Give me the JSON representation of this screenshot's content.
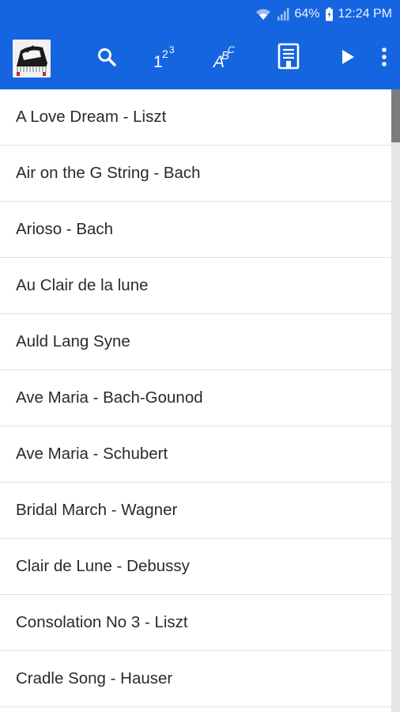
{
  "status_bar": {
    "battery_percent": "64%",
    "time": "12:24 PM",
    "icons": [
      "wifi-icon",
      "signal-icon",
      "battery-icon"
    ]
  },
  "toolbar": {
    "app_icon": "piano-app-icon",
    "actions": [
      "search-icon",
      "number-sort-icon",
      "alpha-sort-icon",
      "bookmark-icon",
      "play-icon",
      "more-vert-icon"
    ],
    "number_label": "123",
    "alpha_label": "ABC"
  },
  "songs": [
    "A Love Dream - Liszt",
    "Air on the G String - Bach",
    "Arioso - Bach",
    "Au Clair de la lune",
    "Auld Lang Syne",
    "Ave Maria - Bach-Gounod",
    "Ave Maria - Schubert",
    "Bridal March - Wagner",
    "Clair de Lune - Debussy",
    "Consolation No 3 - Liszt",
    "Cradle Song - Hauser"
  ],
  "colors": {
    "primary": "#1565e0",
    "divider": "#e3e3e3",
    "text": "#2a2a2a"
  }
}
